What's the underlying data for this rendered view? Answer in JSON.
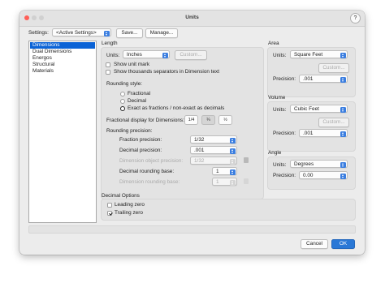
{
  "window": {
    "title": "Units",
    "help_label": "?"
  },
  "settings": {
    "label": "Settings:",
    "value": "<Active Settings>",
    "save_label": "Save...",
    "manage_label": "Manage..."
  },
  "categories": [
    {
      "label": "Dimensions",
      "selected": true
    },
    {
      "label": "Dual Dimensions",
      "selected": false
    },
    {
      "label": "Energos",
      "selected": false
    },
    {
      "label": "Structural",
      "selected": false
    },
    {
      "label": "Materials",
      "selected": false
    }
  ],
  "length": {
    "section_label": "Length",
    "units_label": "Units:",
    "units_value": "Inches",
    "custom_label": "Custom...",
    "show_unit_mark_label": "Show unit mark",
    "show_unit_mark_checked": false,
    "show_thousands_label": "Show thousands separators in Dimension text",
    "show_thousands_checked": false,
    "rounding_style_label": "Rounding style:",
    "rounding_options": [
      {
        "label": "Fractional",
        "selected": false
      },
      {
        "label": "Decimal",
        "selected": false
      },
      {
        "label": "Exact as fractions / non-exact as decimals",
        "selected": true
      }
    ],
    "fractional_display_label": "Fractional display for Dimensions:",
    "fraction_styles": [
      {
        "glyph": "1/4",
        "selected": false
      },
      {
        "glyph": "¼",
        "selected": true
      },
      {
        "glyph": "½",
        "selected": false
      }
    ],
    "rounding_precision_label": "Rounding precision:",
    "fraction_precision_label": "Fraction precision:",
    "fraction_precision_value": "1/32",
    "decimal_precision_label": "Decimal precision:",
    "decimal_precision_value": ".001",
    "dimension_object_precision_label": "Dimension object precision:",
    "dimension_object_precision_value": "1/32",
    "decimal_rounding_base_label": "Decimal rounding base:",
    "decimal_rounding_base_value": "1",
    "dimension_rounding_base_label": "Dimension rounding base:",
    "dimension_rounding_base_value": "1"
  },
  "area": {
    "section_label": "Area",
    "units_label": "Units:",
    "units_value": "Square Feet",
    "custom_label": "Custom...",
    "precision_label": "Precision:",
    "precision_value": ".001"
  },
  "volume": {
    "section_label": "Volume",
    "units_label": "Units:",
    "units_value": "Cubic Feet",
    "custom_label": "Custom...",
    "precision_label": "Precision:",
    "precision_value": ".001"
  },
  "angle": {
    "section_label": "Angle",
    "units_label": "Units:",
    "units_value": "Degrees",
    "precision_label": "Precision:",
    "precision_value": "0.00"
  },
  "decimal_options": {
    "section_label": "Decimal Options",
    "leading_zero_label": "Leading zero",
    "leading_zero_checked": false,
    "trailing_zero_label": "Trailing zero",
    "trailing_zero_checked": true
  },
  "footer": {
    "cancel_label": "Cancel",
    "ok_label": "OK"
  },
  "colors": {
    "accent": "#0b63d6",
    "ok_button": "#2a78d6",
    "close": "#ff5f57",
    "minimize": "#febc2e",
    "zoom": "#28c840"
  }
}
